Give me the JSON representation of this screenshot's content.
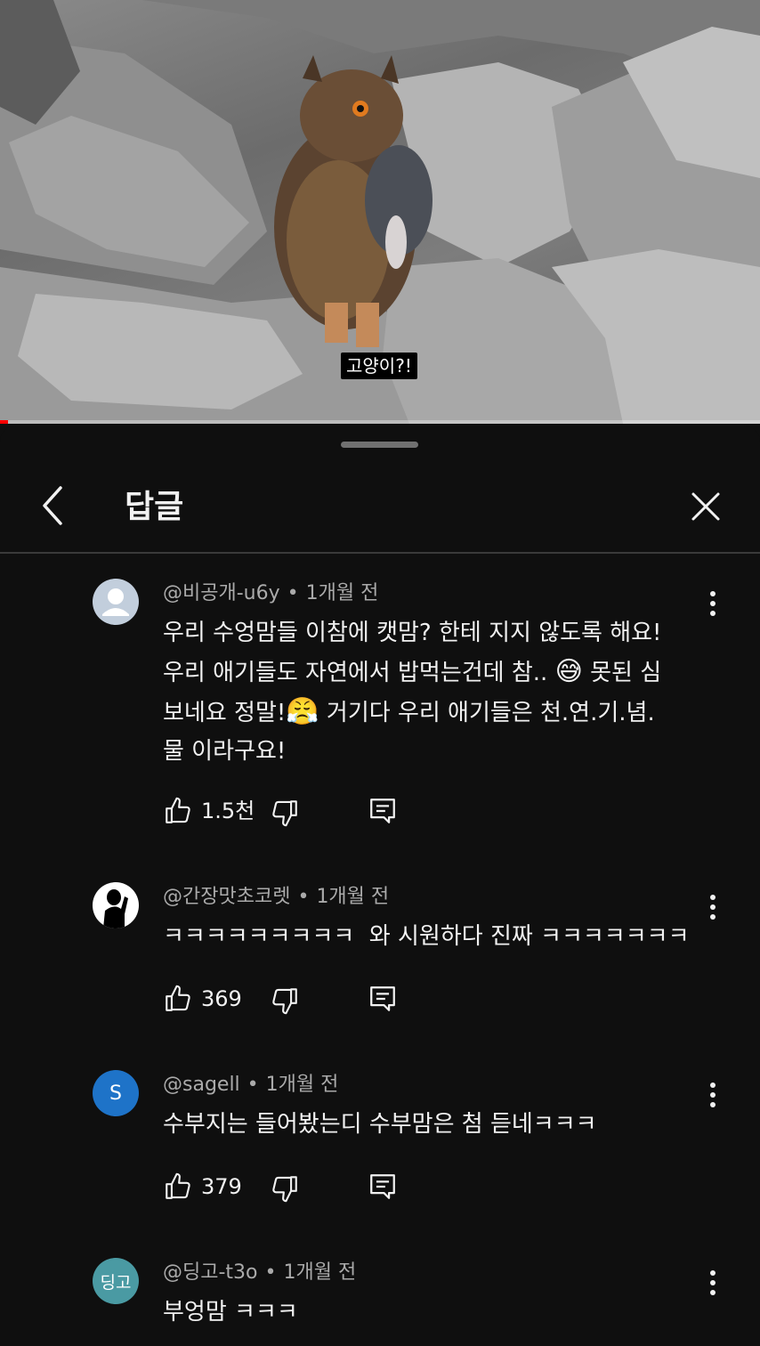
{
  "video": {
    "subtitle": "고양이?!",
    "progress": 0.01
  },
  "sheet": {
    "title": "답글",
    "back_icon": "chevron-left-icon",
    "close_icon": "close-icon"
  },
  "comments": [
    {
      "author": "@비공개-u6y",
      "time": "1개월 전",
      "avatar_type": "default-person",
      "avatar_color": "#c2cedc",
      "lines": [
        "우리 수엉맘들 이참에 캣맘? 한테 지지 않도록 해요!",
        "우리 애기들도 자연에서 밥먹는건데 참..",
        "못된 심",
        "보네요 정말!",
        "거기다 우리 애기들은 천.연.기.념.",
        "물 이라구요!"
      ],
      "emoji_1": "😅",
      "emoji_2": "😤",
      "likes": "1.5천"
    },
    {
      "author": "@간장맛초코렛",
      "time": "1개월 전",
      "avatar_type": "silhouette",
      "avatar_color": "#ffffff",
      "text": "ㅋㅋㅋㅋㅋㅋㅋㅋㅋ  와 시원하다 진짜 ㅋㅋㅋㅋㅋㅋㅋ",
      "likes": "369"
    },
    {
      "author": "@sagell",
      "time": "1개월 전",
      "avatar_type": "letter",
      "avatar_letter": "S",
      "avatar_color": "#1e73c8",
      "text": "수부지는 들어봤는디 수부맘은 첨 듣네ㅋㅋㅋ",
      "likes": "379"
    },
    {
      "author": "@딩고-t3o",
      "time": "1개월 전",
      "avatar_type": "letter",
      "avatar_letter": "딩고",
      "avatar_color": "#4a9aa3",
      "text": "부엉맘 ㅋㅋㅋ",
      "likes": ""
    }
  ]
}
